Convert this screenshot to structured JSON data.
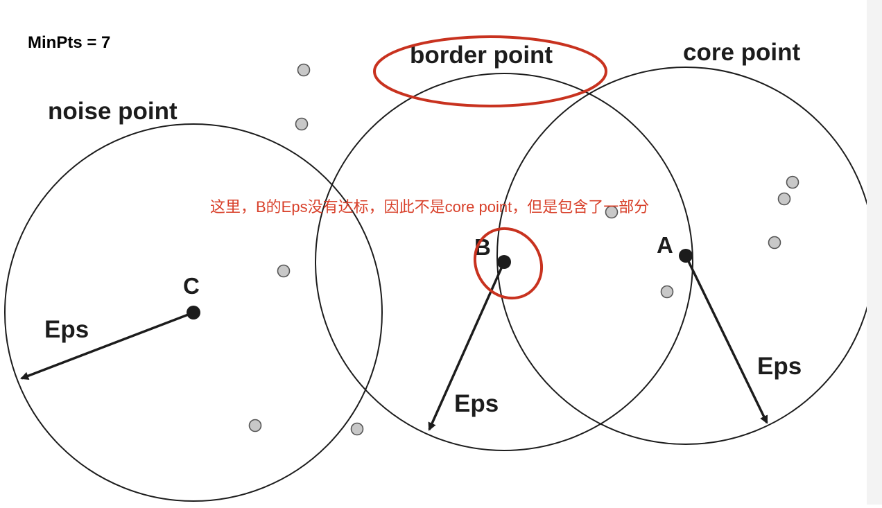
{
  "minpts_label": "MinPts = 7",
  "labels": {
    "noise_point": "noise point",
    "border_point": "border point",
    "core_point": "core point"
  },
  "points": {
    "a": "A",
    "b": "B",
    "c": "C"
  },
  "eps_label": "Eps",
  "annotation": "这里，B的Eps没有达标，因此不是core point，但是包含了一部分",
  "colors": {
    "stroke": "#1c1c1c",
    "annotation": "#d8402a",
    "highlight": "#c8321f",
    "neighbor_fill": "#c8c8c8",
    "neighbor_stroke": "#555555"
  }
}
